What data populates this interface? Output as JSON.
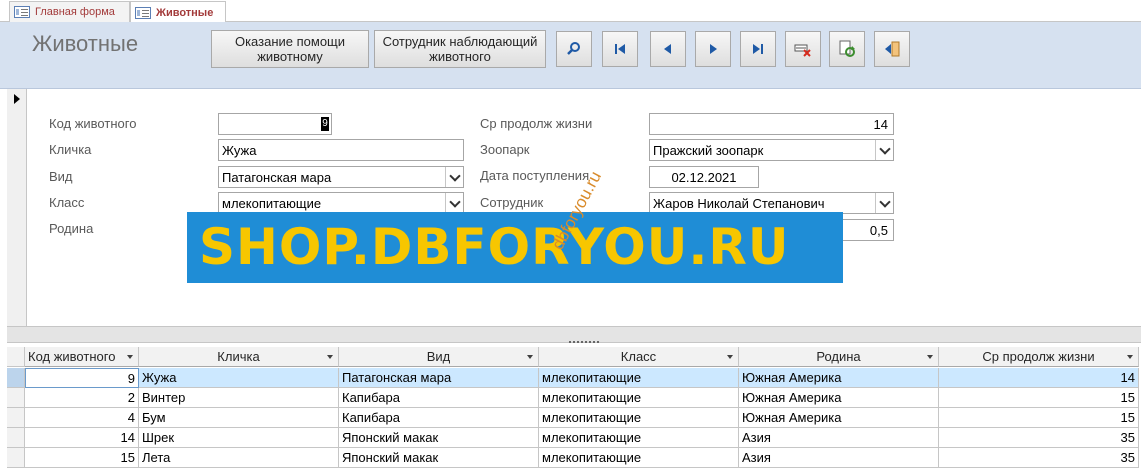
{
  "tabs": [
    {
      "label": "Главная форма",
      "active": false
    },
    {
      "label": "Животные",
      "active": true
    }
  ],
  "header": {
    "title": "Животные",
    "btn_help": "Оказание помощи животному",
    "btn_staff": "Сотрудник наблюдающий животного",
    "icons": [
      "search-icon",
      "first-record-icon",
      "prev-record-icon",
      "next-record-icon",
      "last-record-icon",
      "delete-record-icon",
      "refresh-icon",
      "close-form-icon"
    ]
  },
  "form": {
    "kod_label": "Код животного",
    "kod_value": "9",
    "klichka_label": "Кличка",
    "klichka_value": "Жужа",
    "vid_label": "Вид",
    "vid_value": "Патагонская мара",
    "klass_label": "Класс",
    "klass_value": "млекопитающие",
    "rodina_label": "Родина",
    "zhizn_label": "Ср продолж жизни",
    "zhizn_value": "14",
    "zoopark_label": "Зоопарк",
    "zoopark_value": "Пражский зоопарк",
    "data_label": "Дата поступления",
    "data_value": "02.12.2021",
    "sotrudnik_label": "Сотрудник",
    "sotrudnik_value": "Жаров Николай Степанович",
    "partial_value": "0,5"
  },
  "watermark": {
    "text": "SHOP.DBFORYOU.RU",
    "diag": "dbforyou.ru"
  },
  "datasheet": {
    "columns": [
      "Код животного",
      "Кличка",
      "Вид",
      "Класс",
      "Родина",
      "Ср продолж жизни"
    ],
    "rows": [
      [
        "9",
        "Жужа",
        "Патагонская мара",
        "млекопитающие",
        "Южная Америка",
        "14"
      ],
      [
        "2",
        "Винтер",
        "Капибара",
        "млекопитающие",
        "Южная Америка",
        "15"
      ],
      [
        "4",
        "Бум",
        "Капибара",
        "млекопитающие",
        "Южная Америка",
        "15"
      ],
      [
        "14",
        "Шрек",
        "Японский макак",
        "млекопитающие",
        "Азия",
        "35"
      ],
      [
        "15",
        "Лета",
        "Японский макак",
        "млекопитающие",
        "Азия",
        "35"
      ]
    ]
  },
  "colors": {
    "header_bg": "#d6e1f0",
    "tab_text": "#a33b3b",
    "watermark_bg": "#1f8dd6",
    "watermark_text": "#f7c600",
    "selected_row": "#cce8ff"
  }
}
